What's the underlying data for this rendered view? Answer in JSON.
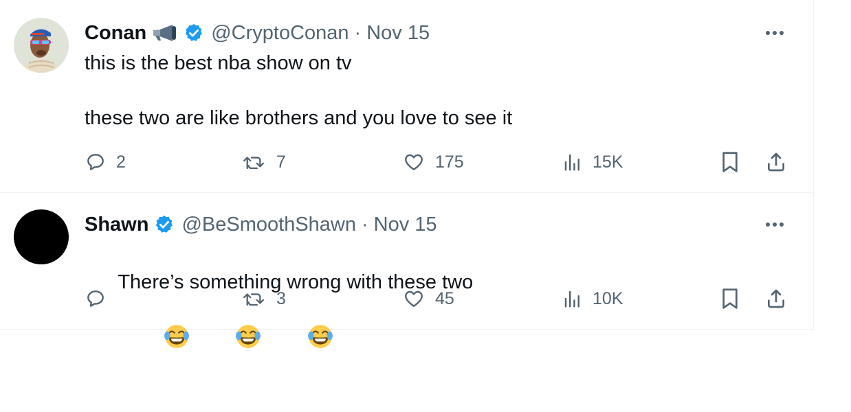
{
  "tweets": [
    {
      "name": "Conan",
      "handle": "@CryptoConan",
      "separator": "·",
      "date": "Nov 15",
      "text": "this is the best nba show on tv\n\nthese two are like brothers and you love to see it",
      "replies": "2",
      "retweets": "7",
      "likes": "175",
      "views": "15K"
    },
    {
      "name": "Shawn",
      "handle": "@BeSmoothShawn",
      "separator": "·",
      "date": "Nov 15",
      "text": "There’s something wrong with these two",
      "emojis": [
        "😂",
        "😂",
        "😂"
      ],
      "replies": "",
      "retweets": "3",
      "likes": "45",
      "views": "10K"
    }
  ],
  "colors": {
    "verified": "#1d9bf0",
    "text": "#0f1419",
    "secondary": "#536471",
    "border": "#eff3f4"
  },
  "icons": [
    "verified-badge-icon",
    "megaphone-icon",
    "more-icon",
    "reply-icon",
    "retweet-icon",
    "like-icon",
    "views-icon",
    "bookmark-icon",
    "share-icon",
    "laughing-emoji-icon"
  ]
}
